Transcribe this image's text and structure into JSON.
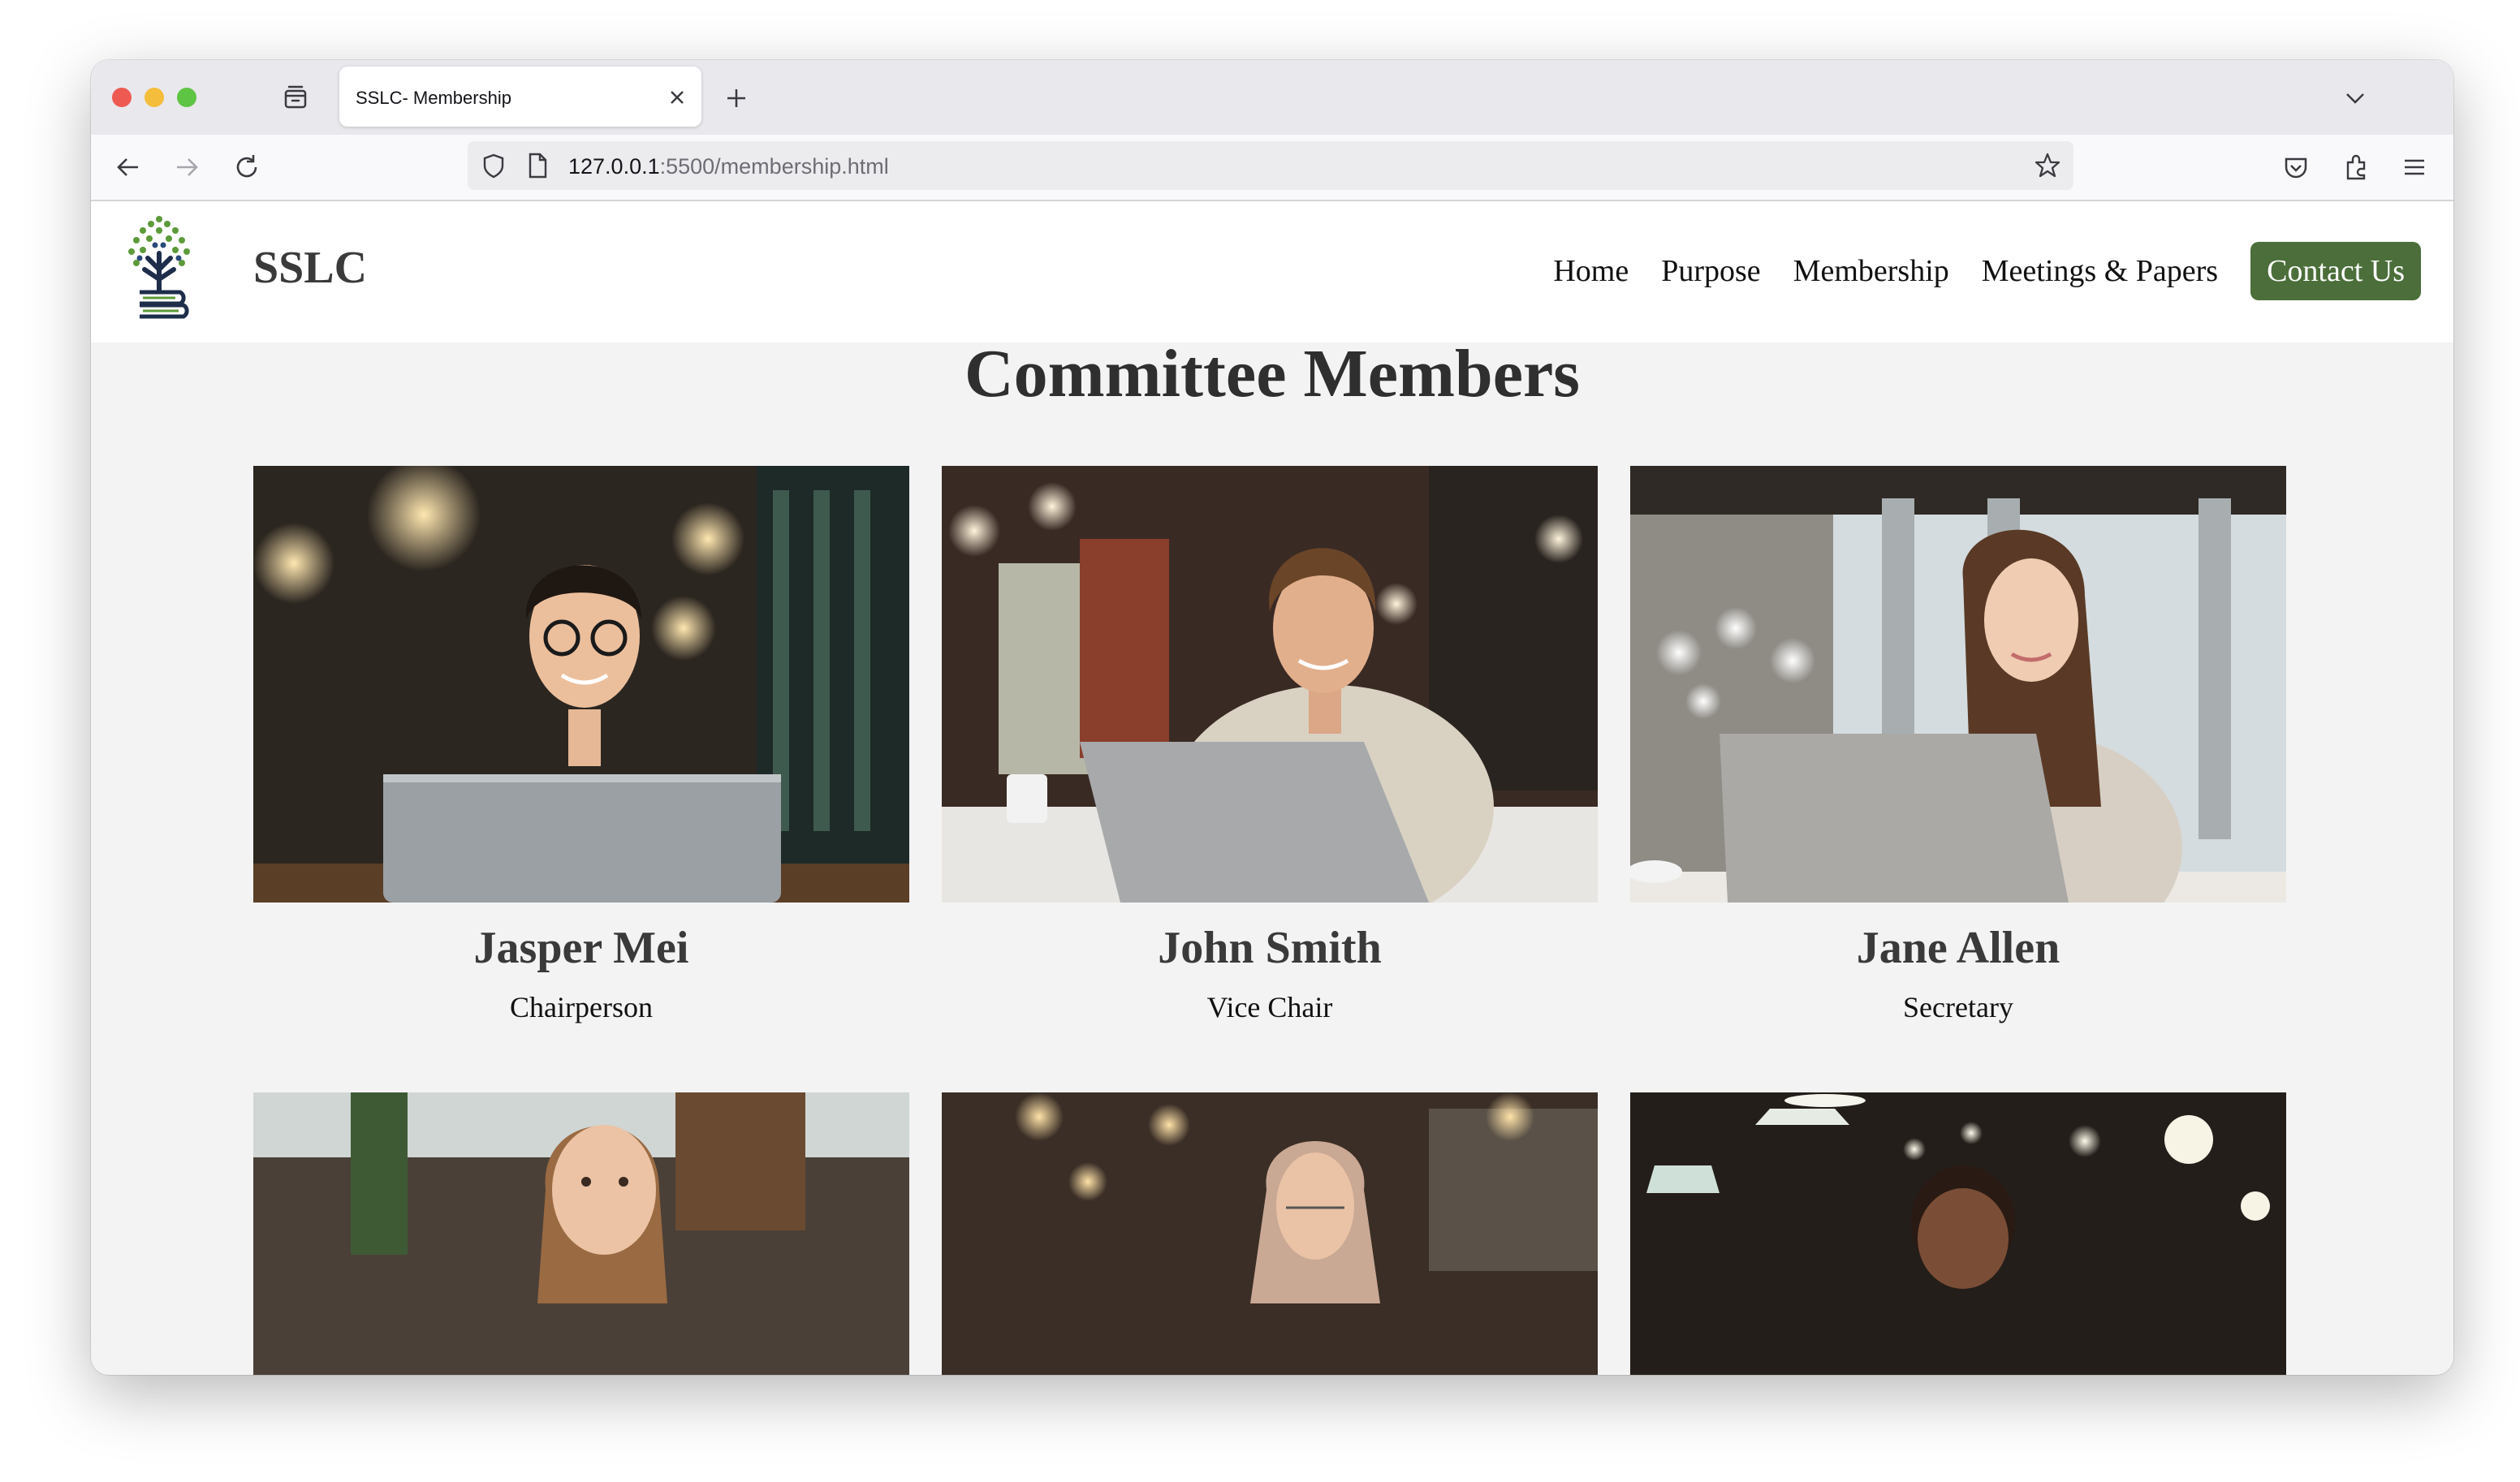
{
  "browser": {
    "tab_title": "SSLC- Membership",
    "url_host": "127.0.0.1",
    "url_rest": ":5500/membership.html"
  },
  "site": {
    "name": "SSLC",
    "nav": [
      "Home",
      "Purpose",
      "Membership",
      "Meetings & Papers"
    ],
    "contact_label": "Contact Us",
    "accent_color": "#4b6e3a"
  },
  "section": {
    "title": "Committee Members"
  },
  "members": [
    {
      "name": "Jasper Mei",
      "role": "Chairperson"
    },
    {
      "name": "John Smith",
      "role": "Vice Chair"
    },
    {
      "name": "Jane Allen",
      "role": "Secretary"
    },
    {
      "name": "",
      "role": ""
    },
    {
      "name": "",
      "role": ""
    },
    {
      "name": "",
      "role": ""
    }
  ]
}
